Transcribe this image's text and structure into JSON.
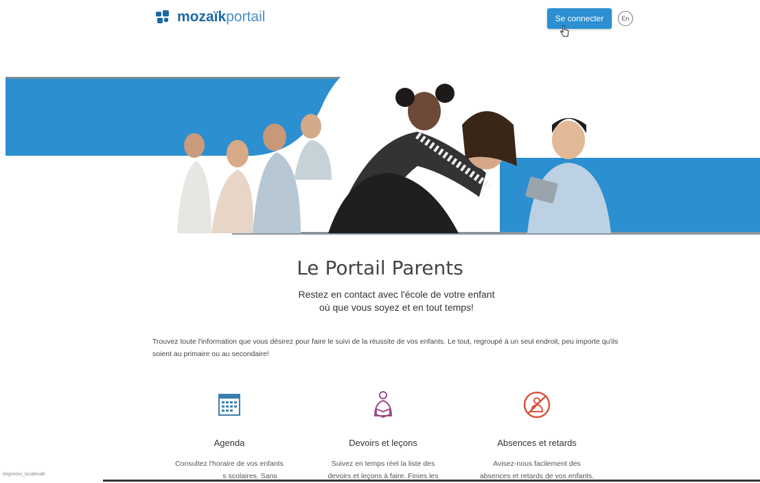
{
  "header": {
    "logo": {
      "brand": "mozaïk",
      "product": "portail"
    },
    "login_label": "Se connecter",
    "lang_label": "En"
  },
  "hero": {
    "image": "family-photo-banner",
    "band_color": "#2b8fd0"
  },
  "main": {
    "title": "Le Portail Parents",
    "subtitle_line1": "Restez en contact avec l'école de votre enfant",
    "subtitle_line2": "où que vous soyez et en tout temps!",
    "intro": "Trouvez toute l'information que vous désirez pour faire le suivi de la réussite de vos enfants. Le tout, regroupé à un seul endroit, peu importe qu'ils soient au primaire ou au secondaire!"
  },
  "features": [
    {
      "icon": "calendar-icon",
      "name": "Agenda",
      "line1": "Consultez l'horaire de vos enfants",
      "line2": "s scolaires. Sans",
      "color": "#3a7fb0"
    },
    {
      "icon": "reading-person-icon",
      "name": "Devoirs et leçons",
      "line1": "Suivez en temps réel la liste des",
      "line2": "devoirs et leçons à faire. Finies les",
      "color": "#9b4d8a"
    },
    {
      "icon": "absence-icon",
      "name": "Absences et retards",
      "line1": "Avisez-nous facilement des",
      "line2": "absences et retards de vos enfants.",
      "color": "#d9523d"
    }
  ],
  "status_bar": {
    "url": "etignmlui_localesafr"
  },
  "colors": {
    "accent": "#2c8fd1",
    "brand": "#1e6aa3"
  }
}
